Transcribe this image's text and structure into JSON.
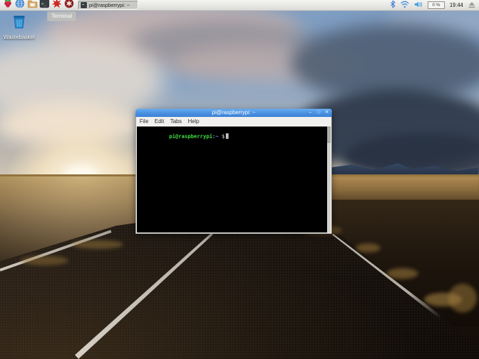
{
  "taskbar": {
    "launchers": [
      {
        "name": "raspberry-menu",
        "icon": "raspberry-icon"
      },
      {
        "name": "web-browser",
        "icon": "globe-icon"
      },
      {
        "name": "file-manager",
        "icon": "folder-icon"
      },
      {
        "name": "terminal",
        "icon": "terminal-icon"
      },
      {
        "name": "mathematica",
        "icon": "starburst-icon"
      },
      {
        "name": "wolfram",
        "icon": "wolfram-icon"
      }
    ],
    "task_button_label": "pi@raspberrypi: ~",
    "cpu_usage": "0 %",
    "clock": "19:44",
    "tooltip": "Terminal",
    "tray_icons": [
      "bluetooth-icon",
      "wifi-icon",
      "volume-icon",
      "eject-icon"
    ]
  },
  "desktop": {
    "wastebasket_label": "Wastebasket"
  },
  "terminal_window": {
    "title": "pi@raspberrypi: ~",
    "buttons": {
      "minimize": "–",
      "maximize": "□",
      "close": "✕"
    },
    "menu_items": [
      "File",
      "Edit",
      "Tabs",
      "Help"
    ],
    "prompt": {
      "user_host": "pi@raspberrypi",
      "separator": ":",
      "path": "~",
      "symbol": " $"
    }
  },
  "colors": {
    "titlebar_blue": "#4a90e0",
    "prompt_green": "#3fda3f",
    "prompt_path_blue": "#7289ff",
    "taskbar_gray": "#e3e3e0"
  }
}
